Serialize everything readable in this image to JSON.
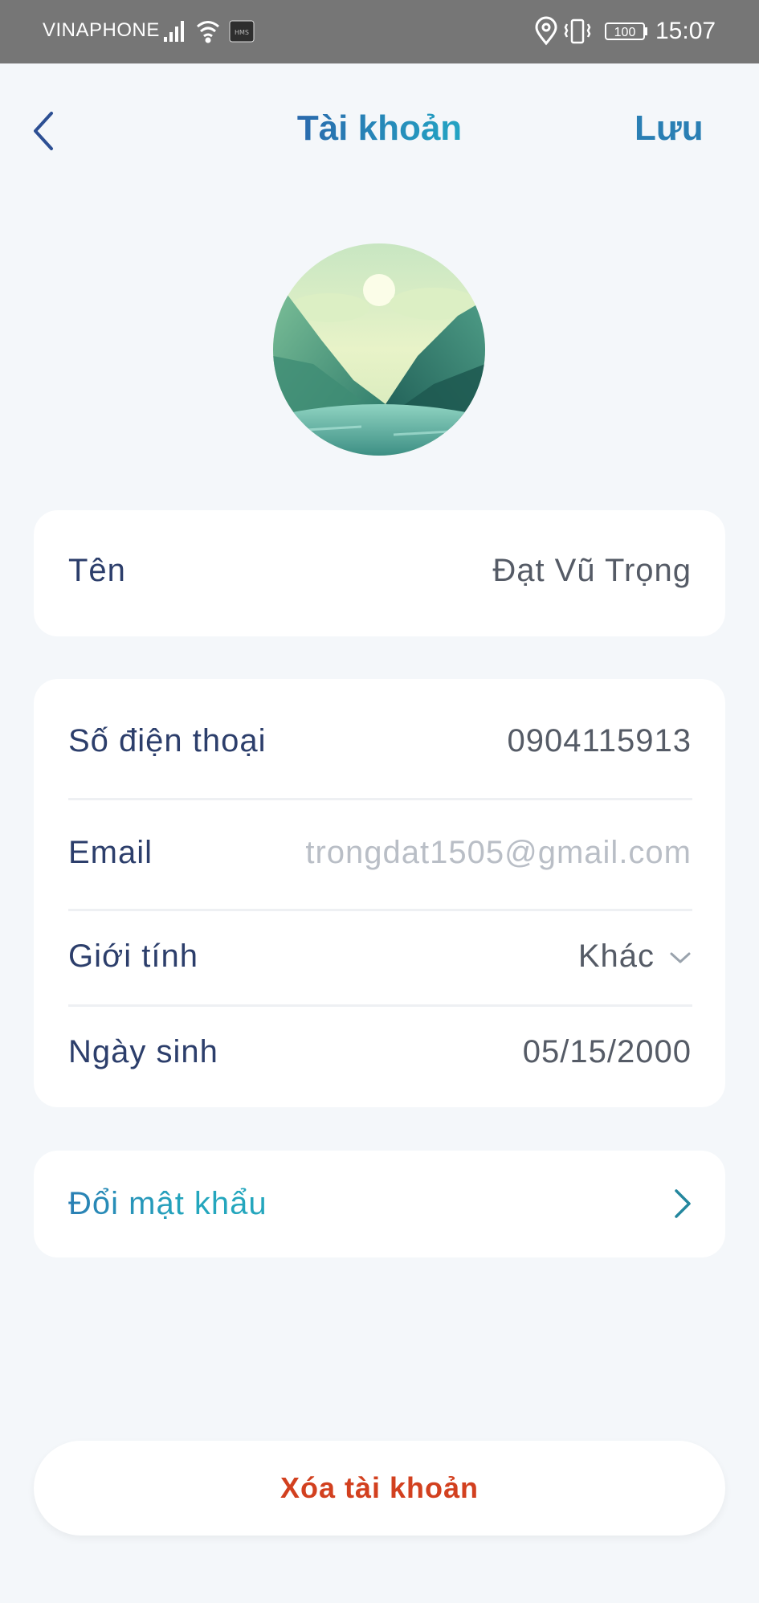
{
  "status_bar": {
    "carrier": "VINAPHONE",
    "battery": "100",
    "time": "15:07",
    "icons": [
      "signal-icon",
      "wifi-icon",
      "hms-icon",
      "location-icon",
      "vibrate-icon",
      "battery-icon"
    ]
  },
  "header": {
    "title": "Tài khoản",
    "save_label": "Lưu",
    "back_icon": "back-chevron-icon"
  },
  "profile": {
    "name_label": "Tên",
    "name_value": "Đạt Vũ Trọng",
    "phone_label": "Số điện thoại",
    "phone_value": "0904115913",
    "email_label": "Email",
    "email_placeholder": "trongdat1505@gmail.com",
    "gender_label": "Giới tính",
    "gender_value": "Khác",
    "birthday_label": "Ngày sinh",
    "birthday_value": "05/15/2000"
  },
  "change_password": {
    "label": "Đổi mật khẩu"
  },
  "delete_account": {
    "label": "Xóa tài khoản"
  },
  "colors": {
    "background": "#f4f7fa",
    "title_gradient_start": "#2b5ea8",
    "title_gradient_end": "#22b0c8",
    "label_text": "#2c3e6b",
    "danger": "#d2401f",
    "status_bar": "#767676"
  }
}
